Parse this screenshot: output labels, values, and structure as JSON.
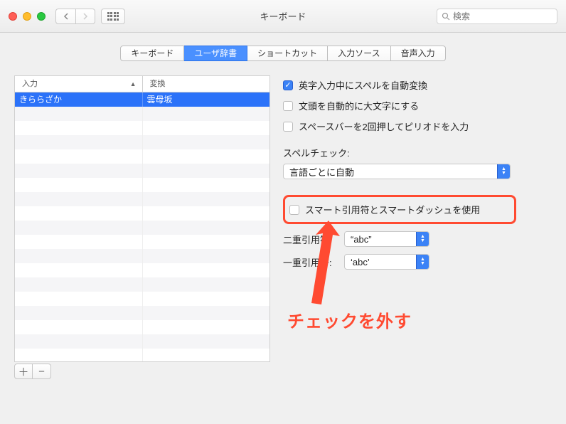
{
  "window": {
    "title": "キーボード"
  },
  "toolbar": {
    "search_placeholder": "検索"
  },
  "tabs": [
    {
      "label": "キーボード",
      "active": false
    },
    {
      "label": "ユーザ辞書",
      "active": true
    },
    {
      "label": "ショートカット",
      "active": false
    },
    {
      "label": "入力ソース",
      "active": false
    },
    {
      "label": "音声入力",
      "active": false
    }
  ],
  "table": {
    "headers": {
      "input": "入力",
      "output": "変換"
    },
    "rows": [
      {
        "input": "きららざか",
        "output": "雲母坂"
      }
    ]
  },
  "buttons": {
    "add": "＋",
    "remove": "−"
  },
  "options": {
    "autocorrect": {
      "label": "英字入力中にスペルを自動変換",
      "checked": true
    },
    "capitalize": {
      "label": "文頭を自動的に大文字にする",
      "checked": false
    },
    "doublespace": {
      "label": "スペースバーを2回押してピリオドを入力",
      "checked": false
    },
    "spellcheck_section": "スペルチェック:",
    "spellcheck_value": "言語ごとに自動",
    "smartquotes": {
      "label": "スマート引用符とスマートダッシュを使用",
      "checked": false
    },
    "doublequote_label": "二重引用符:",
    "doublequote_value": "“abc”",
    "singlequote_label": "一重引用符:",
    "singlequote_value": "‘abc’"
  },
  "annotation": {
    "text": "チェックを外す"
  }
}
